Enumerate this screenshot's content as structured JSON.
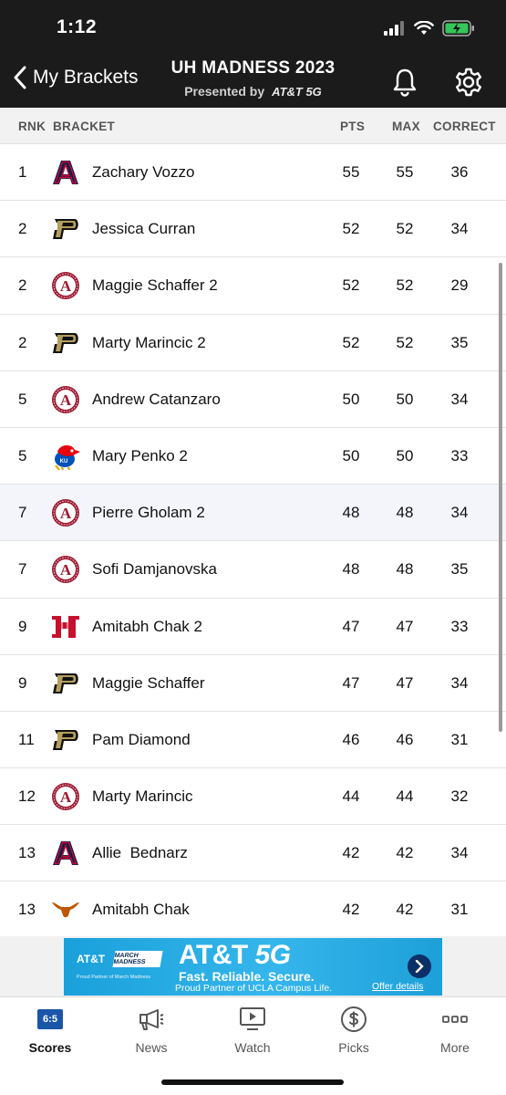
{
  "status": {
    "time": "1:12"
  },
  "header": {
    "back_label": "My Brackets",
    "title": "UH MADNESS 2023",
    "presented_by": "Presented by",
    "sponsor": "AT&T 5G"
  },
  "columns": {
    "rank": "RNK",
    "bracket": "BRACKET",
    "pts": "PTS",
    "max": "MAX",
    "correct": "CORRECT"
  },
  "rows": [
    {
      "rank": "1",
      "name": "Zachary Vozzo",
      "pts": "55",
      "max": "55",
      "correct": "36",
      "team": "arizona"
    },
    {
      "rank": "2",
      "name": "Jessica Curran",
      "pts": "52",
      "max": "52",
      "correct": "34",
      "team": "purdue"
    },
    {
      "rank": "2",
      "name": "Maggie Schaffer 2",
      "pts": "52",
      "max": "52",
      "correct": "29",
      "team": "alabama"
    },
    {
      "rank": "2",
      "name": "Marty Marincic 2",
      "pts": "52",
      "max": "52",
      "correct": "35",
      "team": "purdue"
    },
    {
      "rank": "5",
      "name": "Andrew Catanzaro",
      "pts": "50",
      "max": "50",
      "correct": "34",
      "team": "alabama"
    },
    {
      "rank": "5",
      "name": "Mary Penko 2",
      "pts": "50",
      "max": "50",
      "correct": "33",
      "team": "kansas"
    },
    {
      "rank": "7",
      "name": "Pierre Gholam 2",
      "pts": "48",
      "max": "48",
      "correct": "34",
      "team": "alabama"
    },
    {
      "rank": "7",
      "name": "Sofi Damjanovska",
      "pts": "48",
      "max": "48",
      "correct": "35",
      "team": "alabama"
    },
    {
      "rank": "9",
      "name": "Amitabh Chak 2",
      "pts": "47",
      "max": "47",
      "correct": "33",
      "team": "houston"
    },
    {
      "rank": "9",
      "name": "Maggie Schaffer",
      "pts": "47",
      "max": "47",
      "correct": "34",
      "team": "purdue"
    },
    {
      "rank": "11",
      "name": "Pam Diamond",
      "pts": "46",
      "max": "46",
      "correct": "31",
      "team": "purdue"
    },
    {
      "rank": "12",
      "name": "Marty Marincic",
      "pts": "44",
      "max": "44",
      "correct": "32",
      "team": "alabama"
    },
    {
      "rank": "13",
      "name": "Allie  Bednarz",
      "pts": "42",
      "max": "42",
      "correct": "34",
      "team": "arizona"
    },
    {
      "rank": "13",
      "name": "Amitabh Chak",
      "pts": "42",
      "max": "42",
      "correct": "31",
      "team": "texas"
    }
  ],
  "ad": {
    "att": "AT&T",
    "march_madness": "MARCH MADNESS",
    "partner": "Proud Partner of March Madness",
    "headline": "AT&T",
    "headline_5g": "5G",
    "tagline": "Fast. Reliable. Secure.",
    "proud": "Proud Partner of UCLA Campus Life.",
    "offer": "Offer details"
  },
  "tabs": {
    "scores_badge": "6:5",
    "scores": "Scores",
    "news": "News",
    "watch": "Watch",
    "picks": "Picks",
    "more": "More"
  },
  "colors": {
    "header_bg": "#1b1b1b",
    "arizona": "#0c234b",
    "arizona_red": "#cc0033",
    "alabama": "#9e1b32",
    "purdue_gold": "#b59f5e",
    "houston": "#c8102e",
    "texas": "#bf5700",
    "kansas_blue": "#0051ba",
    "kansas_red": "#e8000d",
    "tab_active": "#1a56a8"
  }
}
